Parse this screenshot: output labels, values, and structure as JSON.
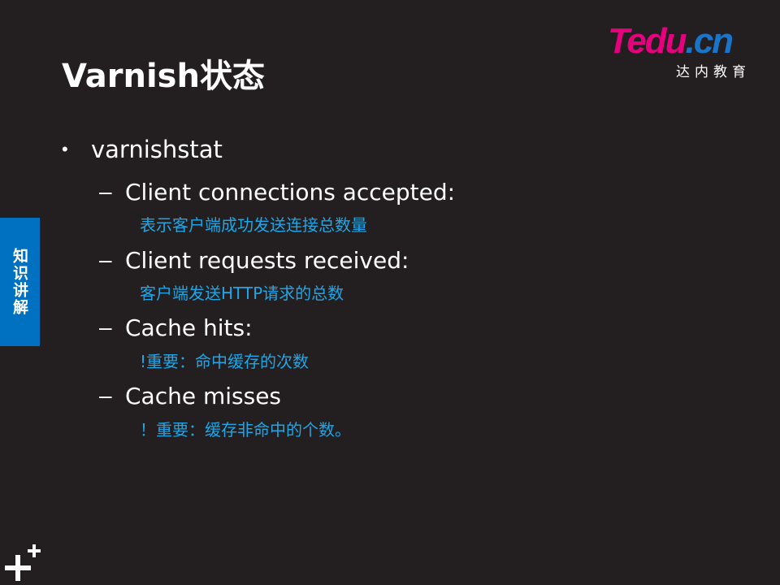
{
  "logo": {
    "brand_main": "Tedu",
    "brand_suffix": ".cn",
    "subtitle": "达内教育"
  },
  "title": "Varnish状态",
  "side_tab": "知识讲解",
  "bullet": {
    "text": "varnishstat"
  },
  "items": [
    {
      "label": "Client connections accepted:",
      "note": "表示客户端成功发送连接总数量"
    },
    {
      "label": "Client requests received:",
      "note": "客户端发送HTTP请求的总数"
    },
    {
      "label": "Cache hits:",
      "note": "!重要：命中缓存的次数"
    },
    {
      "label": "Cache misses",
      "note": "！重要：缓存非命中的个数。"
    }
  ],
  "colors": {
    "background": "#231f20",
    "note": "#1ea6e6",
    "side_tab": "#0070c0",
    "logo_pink": "#e6007e",
    "logo_blue": "#1a74c9"
  }
}
